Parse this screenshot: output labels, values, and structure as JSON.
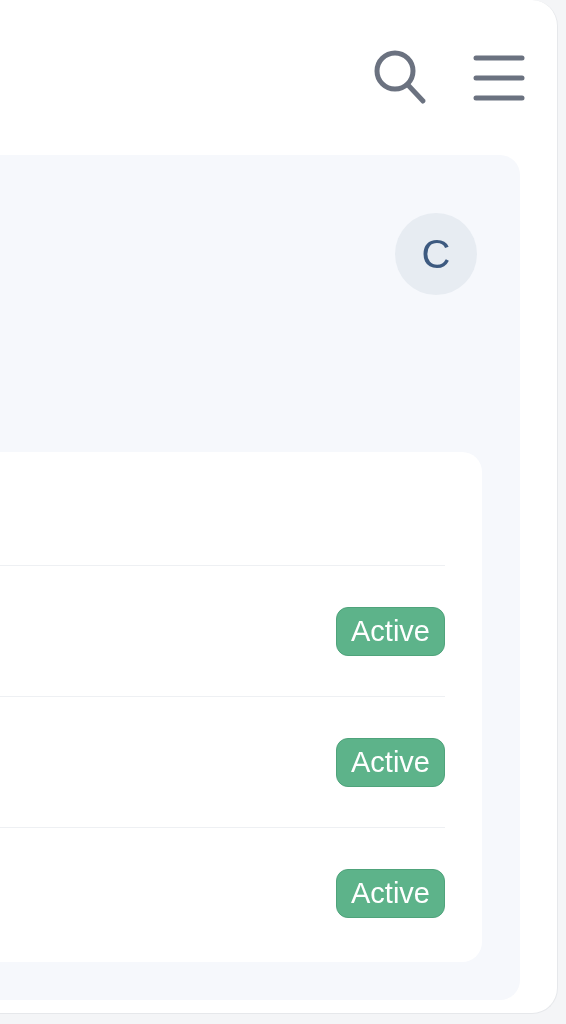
{
  "profile": {
    "initial": "C"
  },
  "rows": [
    {
      "status": "Active"
    },
    {
      "status": "Active"
    },
    {
      "status": "Active"
    }
  ]
}
